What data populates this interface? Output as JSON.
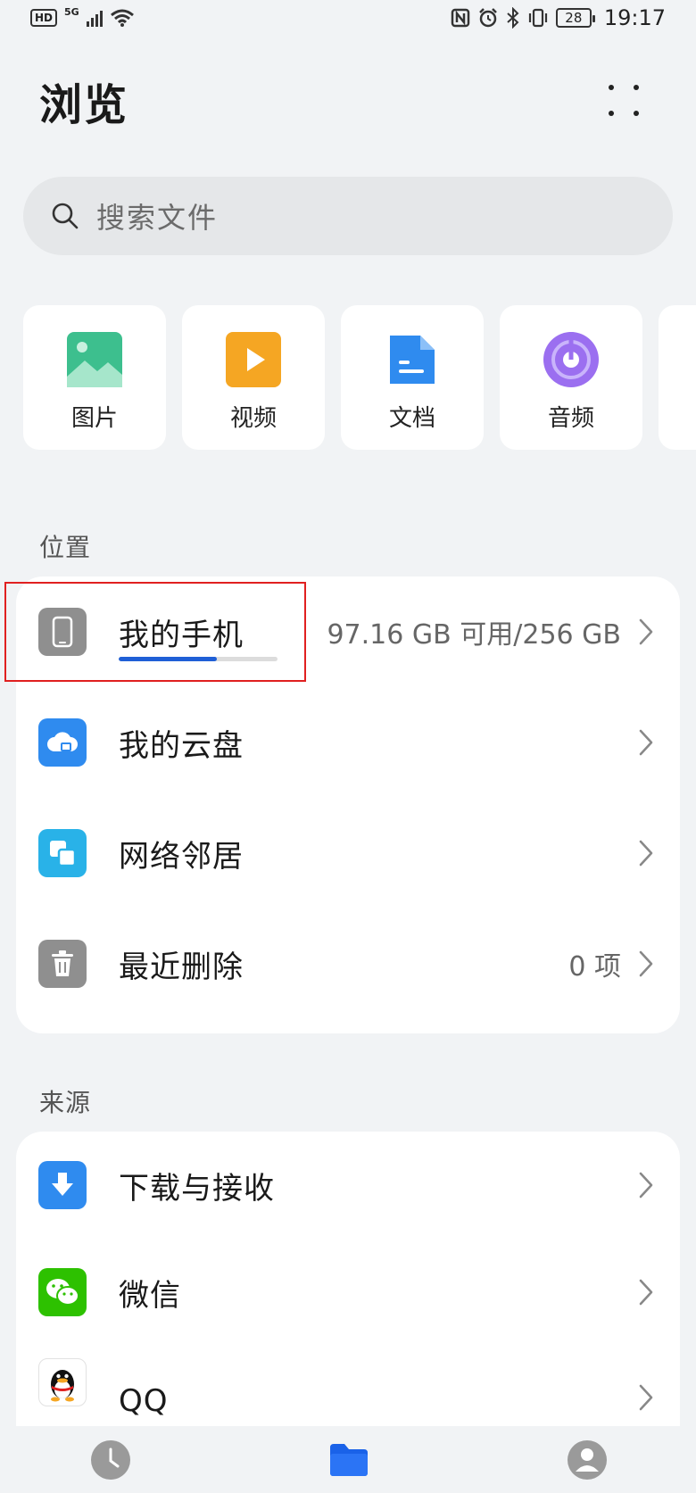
{
  "status_bar": {
    "hd": "HD",
    "network": "5G",
    "battery": "28",
    "time": "19:17"
  },
  "header": {
    "title": "浏览"
  },
  "search": {
    "placeholder": "搜索文件"
  },
  "categories": [
    {
      "label": "图片",
      "icon": "image-icon",
      "color": "#3dbf8e"
    },
    {
      "label": "视频",
      "icon": "video-icon",
      "color": "#f5a623"
    },
    {
      "label": "文档",
      "icon": "document-icon",
      "color": "#2f8bef"
    },
    {
      "label": "音频",
      "icon": "audio-icon",
      "color": "#9b6ff0"
    }
  ],
  "location": {
    "section_label": "位置",
    "items": [
      {
        "label": "我的手机",
        "meta": "97.16 GB 可用/256 GB",
        "icon": "phone-icon",
        "color": "#8f8f8f",
        "storage_used_fraction": 0.62
      },
      {
        "label": "我的云盘",
        "meta": "",
        "icon": "cloud-icon",
        "color": "#2f8bef"
      },
      {
        "label": "网络邻居",
        "meta": "",
        "icon": "network-icon",
        "color": "#29b2e8"
      },
      {
        "label": "最近删除",
        "meta": "0 项",
        "icon": "trash-icon",
        "color": "#8f8f8f"
      }
    ]
  },
  "sources": {
    "section_label": "来源",
    "items": [
      {
        "label": "下载与接收",
        "icon": "download-icon",
        "color": "#2f8bef"
      },
      {
        "label": "微信",
        "icon": "wechat-icon",
        "color": "#2dc100"
      },
      {
        "label": "QQ",
        "icon": "qq-icon",
        "color": "#ffffff"
      }
    ]
  },
  "bottom_nav": [
    {
      "name": "recent",
      "icon": "clock-icon"
    },
    {
      "name": "browse",
      "icon": "folder-icon",
      "active": true
    },
    {
      "name": "profile",
      "icon": "user-icon"
    }
  ]
}
